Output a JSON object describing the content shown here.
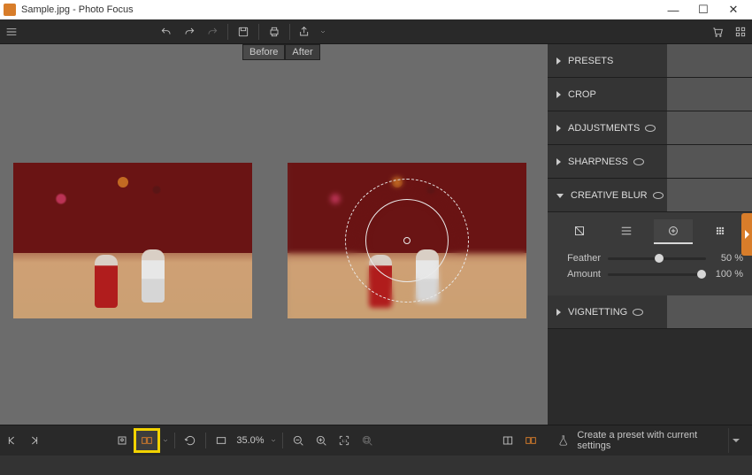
{
  "window": {
    "title": "Sample.jpg - Photo Focus"
  },
  "view_tabs": {
    "before": "Before",
    "after": "After"
  },
  "zoom": {
    "level": "35.0%"
  },
  "panels": {
    "presets": "PRESETS",
    "crop": "CROP",
    "adjustments": "ADJUSTMENTS",
    "sharpness": "SHARPNESS",
    "creative_blur": "CREATIVE BLUR",
    "vignetting": "VIGNETTING"
  },
  "creative_blur": {
    "sliders": {
      "feather": {
        "label": "Feather",
        "value": "50 %",
        "pos": 50
      },
      "amount": {
        "label": "Amount",
        "value": "100 %",
        "pos": 100
      }
    }
  },
  "footer": {
    "preset_label": "Create a preset with current settings"
  }
}
